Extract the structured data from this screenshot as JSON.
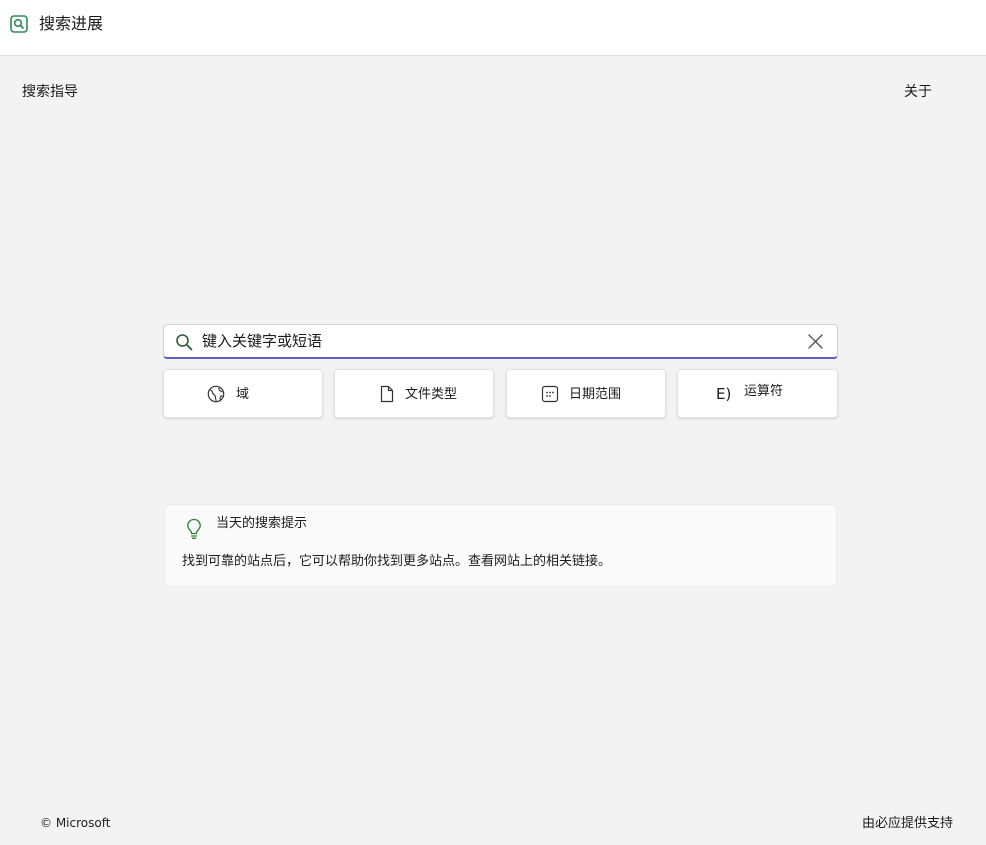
{
  "app": {
    "title": "搜索进展",
    "accent_color": "#2e8b57"
  },
  "nav": {
    "guide_label": "搜索指导",
    "about_label": "关于"
  },
  "search": {
    "placeholder": "键入关键字或短语",
    "value": "",
    "underline_color": "#5b5fc7"
  },
  "filters": [
    {
      "label": "域",
      "icon": "globe-icon"
    },
    {
      "label": "文件类型",
      "icon": "document-icon"
    },
    {
      "label": "日期范围",
      "icon": "calendar-icon"
    },
    {
      "label": "运算符",
      "icon_text": "E)"
    }
  ],
  "tip": {
    "title": "当天的搜索提示",
    "body": "找到可靠的站点后，它可以帮助你找到更多站点。查看网站上的相关链接。"
  },
  "footer": {
    "copyright": "© Microsoft",
    "powered_by": "由必应提供支持"
  }
}
